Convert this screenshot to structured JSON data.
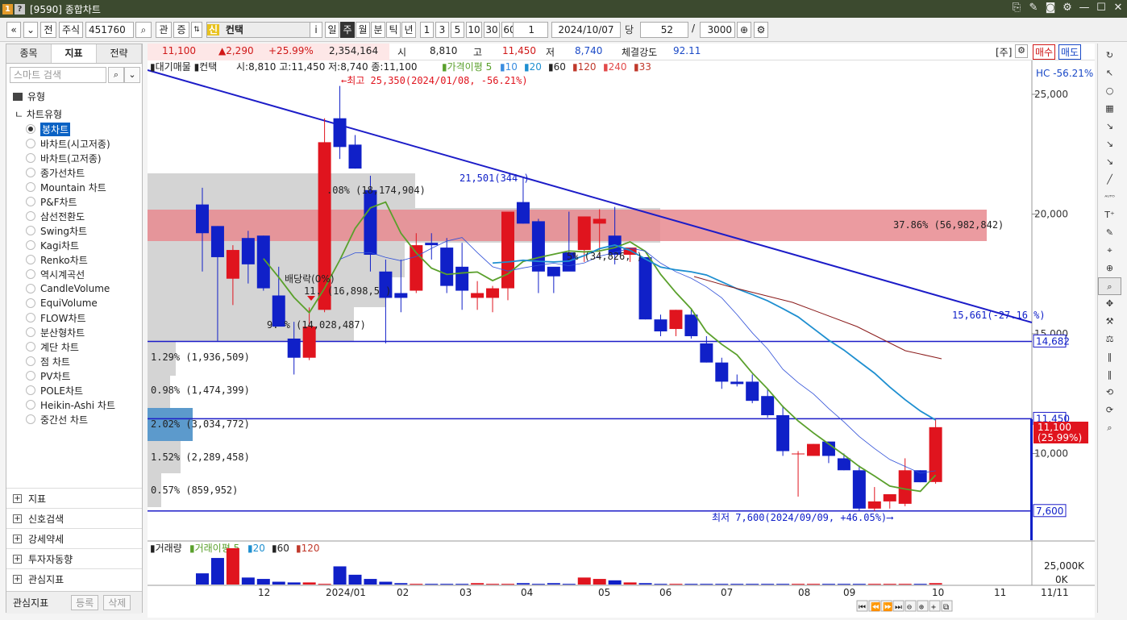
{
  "window": {
    "title": "[9590] 종합차트",
    "badge1": "1",
    "badge2": "?"
  },
  "toolbar": {
    "nav_prev": "«",
    "nav_down": "⌄",
    "jeon": "전",
    "market": "주식",
    "code": "451760",
    "gwan": "관",
    "jeung": "증",
    "new_badge": "신",
    "stock_name": "컨택",
    "info": "i",
    "periods": [
      "일",
      "주",
      "월",
      "분",
      "틱",
      "년"
    ],
    "active_period": "주",
    "intervals": [
      "1",
      "3",
      "5",
      "10",
      "30",
      "60"
    ],
    "interval_value": "1",
    "date": "2024/10/07",
    "dang": "당",
    "count": "52",
    "slash": "/",
    "max": "3000"
  },
  "left_panel": {
    "tabs": [
      "종목",
      "지표",
      "전략"
    ],
    "active_tab": "지표",
    "search_placeholder": "스마트 검색",
    "folder": "유형",
    "sub_header": "차트유형",
    "chart_types": [
      "봉차트",
      "바차트(시고저종)",
      "바차트(고저종)",
      "종가선차트",
      "Mountain 차트",
      "P&F차트",
      "삼선전환도",
      "Swing차트",
      "Kagi차트",
      "Renko차트",
      "역시계곡선",
      "CandleVolume",
      "EquiVolume",
      "FLOW차트",
      "분산형차트",
      "계단 차트",
      "점 차트",
      "PV차트",
      "POLE차트",
      "Heikin-Ashi 차트",
      "중간선 차트"
    ],
    "selected_type": "봉차트",
    "sections": [
      "지표",
      "신호검색",
      "강세약세",
      "투자자동향",
      "관심지표"
    ],
    "bottom_label": "관심지표",
    "bottom_btn1": "등록",
    "bottom_btn2": "삭제"
  },
  "info_bar": {
    "price": "11,100",
    "change": "▲2,290",
    "change_pct": "+25.99%",
    "volume": "2,354,164",
    "open_label": "시",
    "open": "8,810",
    "high_label": "고",
    "high": "11,450",
    "low_label": "저",
    "low": "8,740",
    "strength_label": "체결강도",
    "strength": "92.11",
    "unit": "[주]",
    "buy": "매수",
    "sell": "매도"
  },
  "price_chart": {
    "legend": {
      "prefix": "▮대기매물 ▮컨택",
      "ohlc": "시:8,810 고:11,450 저:8,740 종:11,100",
      "ma_label": "▮가격이평 5",
      "ma_periods": [
        "10",
        "20",
        "60",
        "120",
        "240",
        "33"
      ],
      "ma_colors": [
        "#3a8de0",
        "#1e8fd0",
        "#222",
        "#c0392b",
        "#e24a4a",
        "#c0392b"
      ]
    },
    "hc_text": "HC -56.21%",
    "y_ticks": [
      "25,000",
      "20,000",
      "15,000",
      "10,000"
    ],
    "price_labels": {
      "high_line": "14,682",
      "close_line": "11,450",
      "current": "11,100",
      "current_pct": "(25.99%)",
      "low_line": "7,600"
    },
    "annotations": {
      "high": "←최고 25,350(2024/01/08, -56.21%)",
      "low": "최저 7,600(2024/09/09, +46.05%)⟶",
      "dividend": "배당락(0%)",
      "trend_end": "15,661(-27.16 %)",
      "p21501": "21,501(344 )"
    },
    "volume_profile": [
      {
        "pct": "37.86%",
        "vol": "(56,982,842)",
        "text": "37.86% (56,982,842)"
      },
      {
        "pct": "",
        "vol": "(34,826,...)",
        "text": "5%  (34,826,   )"
      },
      {
        "pct": "",
        "vol": "(18,174,904)",
        "text": ".08% (18,174,904)"
      },
      {
        "pct": "",
        "vol": "(16,898,5..)",
        "text": "11.  (16,898,5  )"
      },
      {
        "pct": "9...%",
        "vol": "(14,028,487)",
        "text": "9.  % (14,028,487)"
      },
      {
        "pct": "1.29%",
        "vol": "(1,936,509)",
        "text": "1.29% (1,936,509)"
      },
      {
        "pct": "0.98%",
        "vol": "(1,474,399)",
        "text": "0.98% (1,474,399)"
      },
      {
        "pct": "2.02%",
        "vol": "(3,034,772)",
        "text": "2.02% (3,034,772)"
      },
      {
        "pct": "1.52%",
        "vol": "(2,289,458)",
        "text": "1.52% (2,289,458)"
      },
      {
        "pct": "0.57%",
        "vol": "(859,952)",
        "text": "0.57% (859,952)"
      }
    ]
  },
  "chart_data": {
    "type": "candlestick",
    "x_labels": [
      "12",
      "2024/01",
      "02",
      "03",
      "04",
      "05",
      "06",
      "07",
      "08",
      "09",
      "10",
      "11"
    ],
    "candles": [
      {
        "o": 20400,
        "h": 21100,
        "l": 17600,
        "c": 19200
      },
      {
        "o": 19500,
        "h": 19500,
        "l": 14700,
        "c": 18200
      },
      {
        "o": 17300,
        "h": 18700,
        "l": 16200,
        "c": 18500
      },
      {
        "o": 19000,
        "h": 19300,
        "l": 17100,
        "c": 17900
      },
      {
        "o": 19100,
        "h": 19100,
        "l": 16800,
        "c": 16900
      },
      {
        "o": 16600,
        "h": 17800,
        "l": 15800,
        "c": 15300
      },
      {
        "o": 14800,
        "h": 15500,
        "l": 13300,
        "c": 14000
      },
      {
        "o": 14000,
        "h": 16100,
        "l": 13900,
        "c": 15300
      },
      {
        "o": 16000,
        "h": 24000,
        "l": 15900,
        "c": 23000
      },
      {
        "o": 24000,
        "h": 25350,
        "l": 22300,
        "c": 22800
      },
      {
        "o": 22900,
        "h": 23300,
        "l": 21900,
        "c": 21900
      },
      {
        "o": 21000,
        "h": 21600,
        "l": 17600,
        "c": 18300
      },
      {
        "o": 17600,
        "h": 18100,
        "l": 14600,
        "c": 16500
      },
      {
        "o": 16700,
        "h": 18100,
        "l": 15900,
        "c": 16500
      },
      {
        "o": 16800,
        "h": 19200,
        "l": 16700,
        "c": 18700
      },
      {
        "o": 18800,
        "h": 19200,
        "l": 18100,
        "c": 18700
      },
      {
        "o": 18600,
        "h": 19000,
        "l": 16700,
        "c": 17000
      },
      {
        "o": 17800,
        "h": 18800,
        "l": 16000,
        "c": 16800
      },
      {
        "o": 16500,
        "h": 17200,
        "l": 16000,
        "c": 16700
      },
      {
        "o": 16500,
        "h": 17000,
        "l": 15900,
        "c": 16900
      },
      {
        "o": 16900,
        "h": 20000,
        "l": 16400,
        "c": 20100
      },
      {
        "o": 20500,
        "h": 21500,
        "l": 19600,
        "c": 19600
      },
      {
        "o": 19700,
        "h": 19800,
        "l": 16700,
        "c": 17600
      },
      {
        "o": 17800,
        "h": 17700,
        "l": 16700,
        "c": 17400
      },
      {
        "o": 18400,
        "h": 20100,
        "l": 17700,
        "c": 17600
      },
      {
        "o": 18500,
        "h": 19900,
        "l": 18000,
        "c": 19900
      },
      {
        "o": 19600,
        "h": 20200,
        "l": 18200,
        "c": 19800
      },
      {
        "o": 19100,
        "h": 20300,
        "l": 17900,
        "c": 18300
      },
      {
        "o": 18300,
        "h": 18600,
        "l": 18000,
        "c": 18600
      },
      {
        "o": 18200,
        "h": 18200,
        "l": 15600,
        "c": 15600
      },
      {
        "o": 15600,
        "h": 15800,
        "l": 14900,
        "c": 15100
      },
      {
        "o": 15200,
        "h": 16000,
        "l": 14900,
        "c": 16000
      },
      {
        "o": 15800,
        "h": 16000,
        "l": 14800,
        "c": 14900
      },
      {
        "o": 14600,
        "h": 14900,
        "l": 13800,
        "c": 13800
      },
      {
        "o": 13800,
        "h": 14000,
        "l": 12700,
        "c": 13000
      },
      {
        "o": 13000,
        "h": 13300,
        "l": 12800,
        "c": 12900
      },
      {
        "o": 13000,
        "h": 13300,
        "l": 12100,
        "c": 12200
      },
      {
        "o": 12400,
        "h": 12700,
        "l": 11500,
        "c": 11600
      },
      {
        "o": 11600,
        "h": 12000,
        "l": 9900,
        "c": 10100
      },
      {
        "o": 10000,
        "h": 10100,
        "l": 8200,
        "c": 10000
      },
      {
        "o": 9900,
        "h": 10400,
        "l": 9900,
        "c": 10400
      },
      {
        "o": 10500,
        "h": 10500,
        "l": 9600,
        "c": 9900
      },
      {
        "o": 9800,
        "h": 10000,
        "l": 9300,
        "c": 9300
      },
      {
        "o": 9300,
        "h": 9500,
        "l": 7600,
        "c": 7700
      },
      {
        "o": 7700,
        "h": 8600,
        "l": 7600,
        "c": 8000
      },
      {
        "o": 8000,
        "h": 8000,
        "l": 7700,
        "c": 8300
      },
      {
        "o": 7900,
        "h": 9800,
        "l": 7800,
        "c": 9300
      },
      {
        "o": 9300,
        "h": 9300,
        "l": 8800,
        "c": 8800
      },
      {
        "o": 8810,
        "h": 11450,
        "l": 8740,
        "c": 11100
      }
    ],
    "volume_ticks": [
      "25,000K",
      "0K"
    ],
    "volume": [
      800,
      1900,
      2600,
      500,
      400,
      200,
      150,
      150,
      50,
      1300,
      700,
      400,
      200,
      100,
      50,
      50,
      50,
      50,
      100,
      50,
      50,
      100,
      50,
      100,
      50,
      500,
      400,
      300,
      150,
      100,
      50,
      50,
      50,
      50,
      50,
      50,
      50,
      50,
      50,
      50,
      50,
      50,
      50,
      50,
      50,
      50,
      50,
      50,
      100
    ]
  },
  "volume_legend": {
    "prefix": "▮거래량",
    "ma_label": "▮거래이평 5",
    "ma_periods": [
      "20",
      "60",
      "120"
    ]
  }
}
